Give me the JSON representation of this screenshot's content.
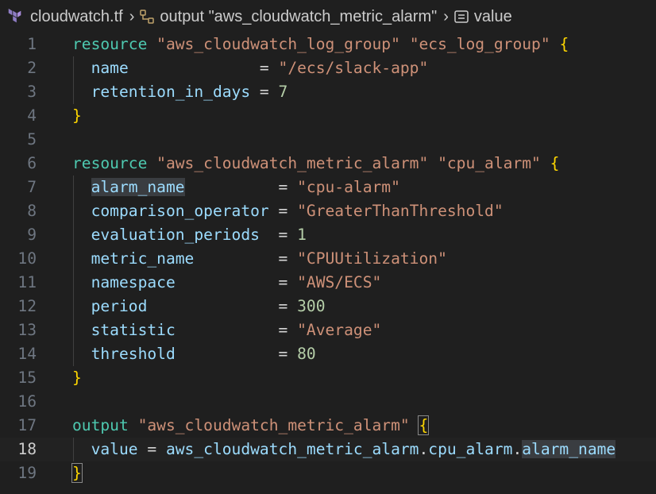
{
  "breadcrumb": {
    "file": "cloudwatch.tf",
    "output": "output \"aws_cloudwatch_metric_alarm\"",
    "value": "value"
  },
  "code_lines": [
    {
      "n": "1",
      "tokens": [
        {
          "c": "kw",
          "t": "resource"
        },
        {
          "c": "op",
          "t": " "
        },
        {
          "c": "str",
          "t": "\"aws_cloudwatch_log_group\""
        },
        {
          "c": "op",
          "t": " "
        },
        {
          "c": "str",
          "t": "\"ecs_log_group\""
        },
        {
          "c": "op",
          "t": " "
        },
        {
          "c": "br",
          "t": "{"
        }
      ]
    },
    {
      "n": "2",
      "tokens": [
        {
          "c": "op",
          "t": "  "
        },
        {
          "c": "attr",
          "t": "name"
        },
        {
          "c": "op",
          "t": "              = "
        },
        {
          "c": "str",
          "t": "\"/ecs/slack-app\""
        }
      ]
    },
    {
      "n": "3",
      "tokens": [
        {
          "c": "op",
          "t": "  "
        },
        {
          "c": "attr",
          "t": "retention_in_days"
        },
        {
          "c": "op",
          "t": " = "
        },
        {
          "c": "num",
          "t": "7"
        }
      ]
    },
    {
      "n": "4",
      "tokens": [
        {
          "c": "br",
          "t": "}"
        }
      ]
    },
    {
      "n": "5",
      "tokens": []
    },
    {
      "n": "6",
      "tokens": [
        {
          "c": "kw",
          "t": "resource"
        },
        {
          "c": "op",
          "t": " "
        },
        {
          "c": "str",
          "t": "\"aws_cloudwatch_metric_alarm\""
        },
        {
          "c": "op",
          "t": " "
        },
        {
          "c": "str",
          "t": "\"cpu_alarm\""
        },
        {
          "c": "op",
          "t": " "
        },
        {
          "c": "br",
          "t": "{"
        }
      ]
    },
    {
      "n": "7",
      "tokens": [
        {
          "c": "op",
          "t": "  "
        },
        {
          "c": "attr hl",
          "t": "alarm_name"
        },
        {
          "c": "op",
          "t": "          = "
        },
        {
          "c": "str",
          "t": "\"cpu-alarm\""
        }
      ]
    },
    {
      "n": "8",
      "tokens": [
        {
          "c": "op",
          "t": "  "
        },
        {
          "c": "attr",
          "t": "comparison_operator"
        },
        {
          "c": "op",
          "t": " = "
        },
        {
          "c": "str",
          "t": "\"GreaterThanThreshold\""
        }
      ]
    },
    {
      "n": "9",
      "tokens": [
        {
          "c": "op",
          "t": "  "
        },
        {
          "c": "attr",
          "t": "evaluation_periods"
        },
        {
          "c": "op",
          "t": "  = "
        },
        {
          "c": "num",
          "t": "1"
        }
      ]
    },
    {
      "n": "10",
      "tokens": [
        {
          "c": "op",
          "t": "  "
        },
        {
          "c": "attr",
          "t": "metric_name"
        },
        {
          "c": "op",
          "t": "         = "
        },
        {
          "c": "str",
          "t": "\"CPUUtilization\""
        }
      ]
    },
    {
      "n": "11",
      "tokens": [
        {
          "c": "op",
          "t": "  "
        },
        {
          "c": "attr",
          "t": "namespace"
        },
        {
          "c": "op",
          "t": "           = "
        },
        {
          "c": "str",
          "t": "\"AWS/ECS\""
        }
      ]
    },
    {
      "n": "12",
      "tokens": [
        {
          "c": "op",
          "t": "  "
        },
        {
          "c": "attr",
          "t": "period"
        },
        {
          "c": "op",
          "t": "              = "
        },
        {
          "c": "num",
          "t": "300"
        }
      ]
    },
    {
      "n": "13",
      "tokens": [
        {
          "c": "op",
          "t": "  "
        },
        {
          "c": "attr",
          "t": "statistic"
        },
        {
          "c": "op",
          "t": "           = "
        },
        {
          "c": "str",
          "t": "\"Average\""
        }
      ]
    },
    {
      "n": "14",
      "tokens": [
        {
          "c": "op",
          "t": "  "
        },
        {
          "c": "attr",
          "t": "threshold"
        },
        {
          "c": "op",
          "t": "           = "
        },
        {
          "c": "num",
          "t": "80"
        }
      ]
    },
    {
      "n": "15",
      "tokens": [
        {
          "c": "br",
          "t": "}"
        }
      ]
    },
    {
      "n": "16",
      "tokens": []
    },
    {
      "n": "17",
      "tokens": [
        {
          "c": "kw",
          "t": "output"
        },
        {
          "c": "op",
          "t": " "
        },
        {
          "c": "str",
          "t": "\"aws_cloudwatch_metric_alarm\""
        },
        {
          "c": "op",
          "t": " "
        },
        {
          "c": "br cursor-box",
          "t": "{"
        }
      ]
    },
    {
      "n": "18",
      "current": true,
      "tokens": [
        {
          "c": "op",
          "t": "  "
        },
        {
          "c": "attr",
          "t": "value"
        },
        {
          "c": "op",
          "t": " = "
        },
        {
          "c": "attr",
          "t": "aws_cloudwatch_metric_alarm"
        },
        {
          "c": "op",
          "t": "."
        },
        {
          "c": "attr",
          "t": "cpu_alarm"
        },
        {
          "c": "op",
          "t": "."
        },
        {
          "c": "attr hl",
          "t": "alarm_name"
        }
      ]
    },
    {
      "n": "19",
      "tokens": [
        {
          "c": "br cursor-box",
          "t": "}"
        }
      ]
    }
  ],
  "colors": {
    "background": "#1f1f1f",
    "keyword": "#4ec9b0",
    "string": "#ce9178",
    "number": "#b5cea8",
    "attribute": "#9cdcfe",
    "bracket": "#ffd700",
    "line_number": "#6e7681"
  },
  "icons": {
    "file": "terraform-icon",
    "output": "symbol-structure-icon",
    "value": "symbol-field-icon",
    "separator": "chevron-right-icon"
  }
}
